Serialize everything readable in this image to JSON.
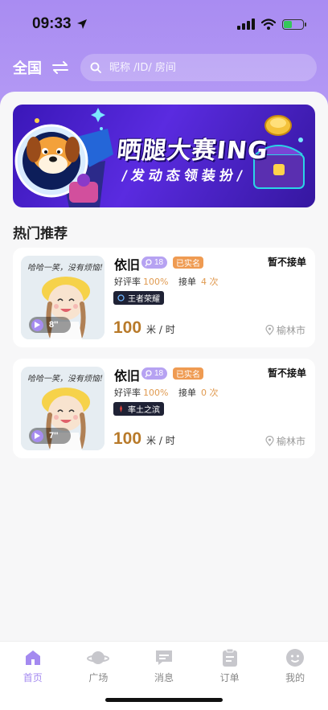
{
  "status_bar": {
    "time": "09:33"
  },
  "header": {
    "region": "全国",
    "search": {
      "placeholder": "昵称 /ID/ 房间"
    }
  },
  "banner": {
    "title": "晒腿大赛ING",
    "subtitle": "/发动态领装扮/"
  },
  "section": {
    "title": "热门推荐"
  },
  "cards": [
    {
      "name": "依旧",
      "age": "18",
      "verified": "已实名",
      "order_status": "暂不接单",
      "rating_label": "好评率",
      "rating_value": "100%",
      "orders_label": "接单",
      "orders_value": "4 次",
      "game_tag": "王者荣耀",
      "price": "100",
      "price_unit": "米 / 时",
      "location": "榆林市",
      "voice_length": "8''",
      "photo_caption": "哈哈一笑，没有烦恼!"
    },
    {
      "name": "依旧",
      "age": "18",
      "verified": "已实名",
      "order_status": "暂不接单",
      "rating_label": "好评率",
      "rating_value": "100%",
      "orders_label": "接单",
      "orders_value": "0 次",
      "game_tag": "率土之滨",
      "price": "100",
      "price_unit": "米 / 时",
      "location": "榆林市",
      "voice_length": "7''",
      "photo_caption": "哈哈一笑，没有烦恼!"
    }
  ],
  "tab_bar": {
    "items": [
      {
        "label": "首页",
        "icon": "home-icon",
        "active": true
      },
      {
        "label": "广场",
        "icon": "planet-icon",
        "active": false
      },
      {
        "label": "消息",
        "icon": "message-icon",
        "active": false
      },
      {
        "label": "订单",
        "icon": "order-icon",
        "active": false
      },
      {
        "label": "我的",
        "icon": "profile-icon",
        "active": false
      }
    ]
  },
  "colors": {
    "accent": "#a48af0",
    "price": "#b87a2a",
    "verified": "#ef9b52",
    "header_bg": "#a98cf2"
  }
}
